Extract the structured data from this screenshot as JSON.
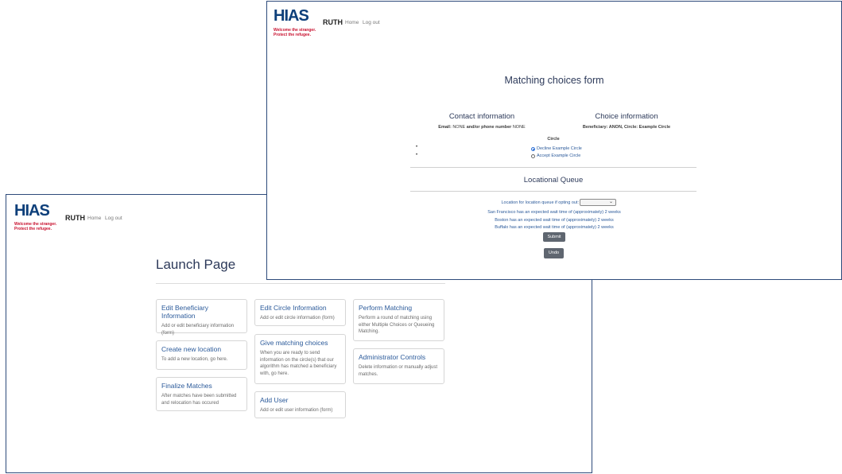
{
  "brand": {
    "logo_word": "HIAS",
    "logo_tagline_1": "Welcome the stranger.",
    "logo_tagline_2": "Protect the refugee.",
    "app_name": "RUTH",
    "nav_home": "Home",
    "nav_logout": "Log out"
  },
  "launch": {
    "title": "Launch Page",
    "cards": [
      {
        "title": "Edit Beneficiary Information",
        "text": "Add or edit beneficiary information (form)"
      },
      {
        "title": "Create new location",
        "text": "To add a new location, go here."
      },
      {
        "title": "Finalize Matches",
        "text": "After matches have been submitted and relocation has occured"
      },
      {
        "title": "Edit Circle Information",
        "text": "Add or edit circle information (form)"
      },
      {
        "title": "Give matching choices",
        "text": "When you are ready to send information on the circle(s) that our algorithm has matched a beneficiary with, go here."
      },
      {
        "title": "Add User",
        "text": "Add or edit user information (form)"
      },
      {
        "title": "Perform Matching",
        "text": "Perform a round of matching using either Multiple Choices or Queueing Matching."
      },
      {
        "title": "Administrator Controls",
        "text": "Delete information or manually adjust matches."
      }
    ]
  },
  "matching": {
    "title": "Matching choices form",
    "contact_head": "Contact information",
    "contact_email_label": "Email:",
    "contact_email_value": "NONE",
    "contact_phone_label": "and/or phone number",
    "contact_phone_value": "NONE",
    "choice_head": "Choice information",
    "choice_line": "Beneficiary: ANON, Circle: Example Circle",
    "circle_label": "Circle",
    "options": [
      {
        "label": "Decline Example Circle",
        "selected": true
      },
      {
        "label": "Accept Example Circle",
        "selected": false
      }
    ],
    "queue_head": "Locational Queue",
    "queue_prompt": "Location for location queue if opting out:",
    "wait_lines": [
      "San Francisco has an expected wait time of (approximately) 2 weeks",
      "Boston has an expected wait time of (approximately) 2 weeks",
      "Buffalo has an expected wait time of (approximately) 2 weeks"
    ],
    "submit_label": "Submit",
    "undo_label": "Undo"
  }
}
